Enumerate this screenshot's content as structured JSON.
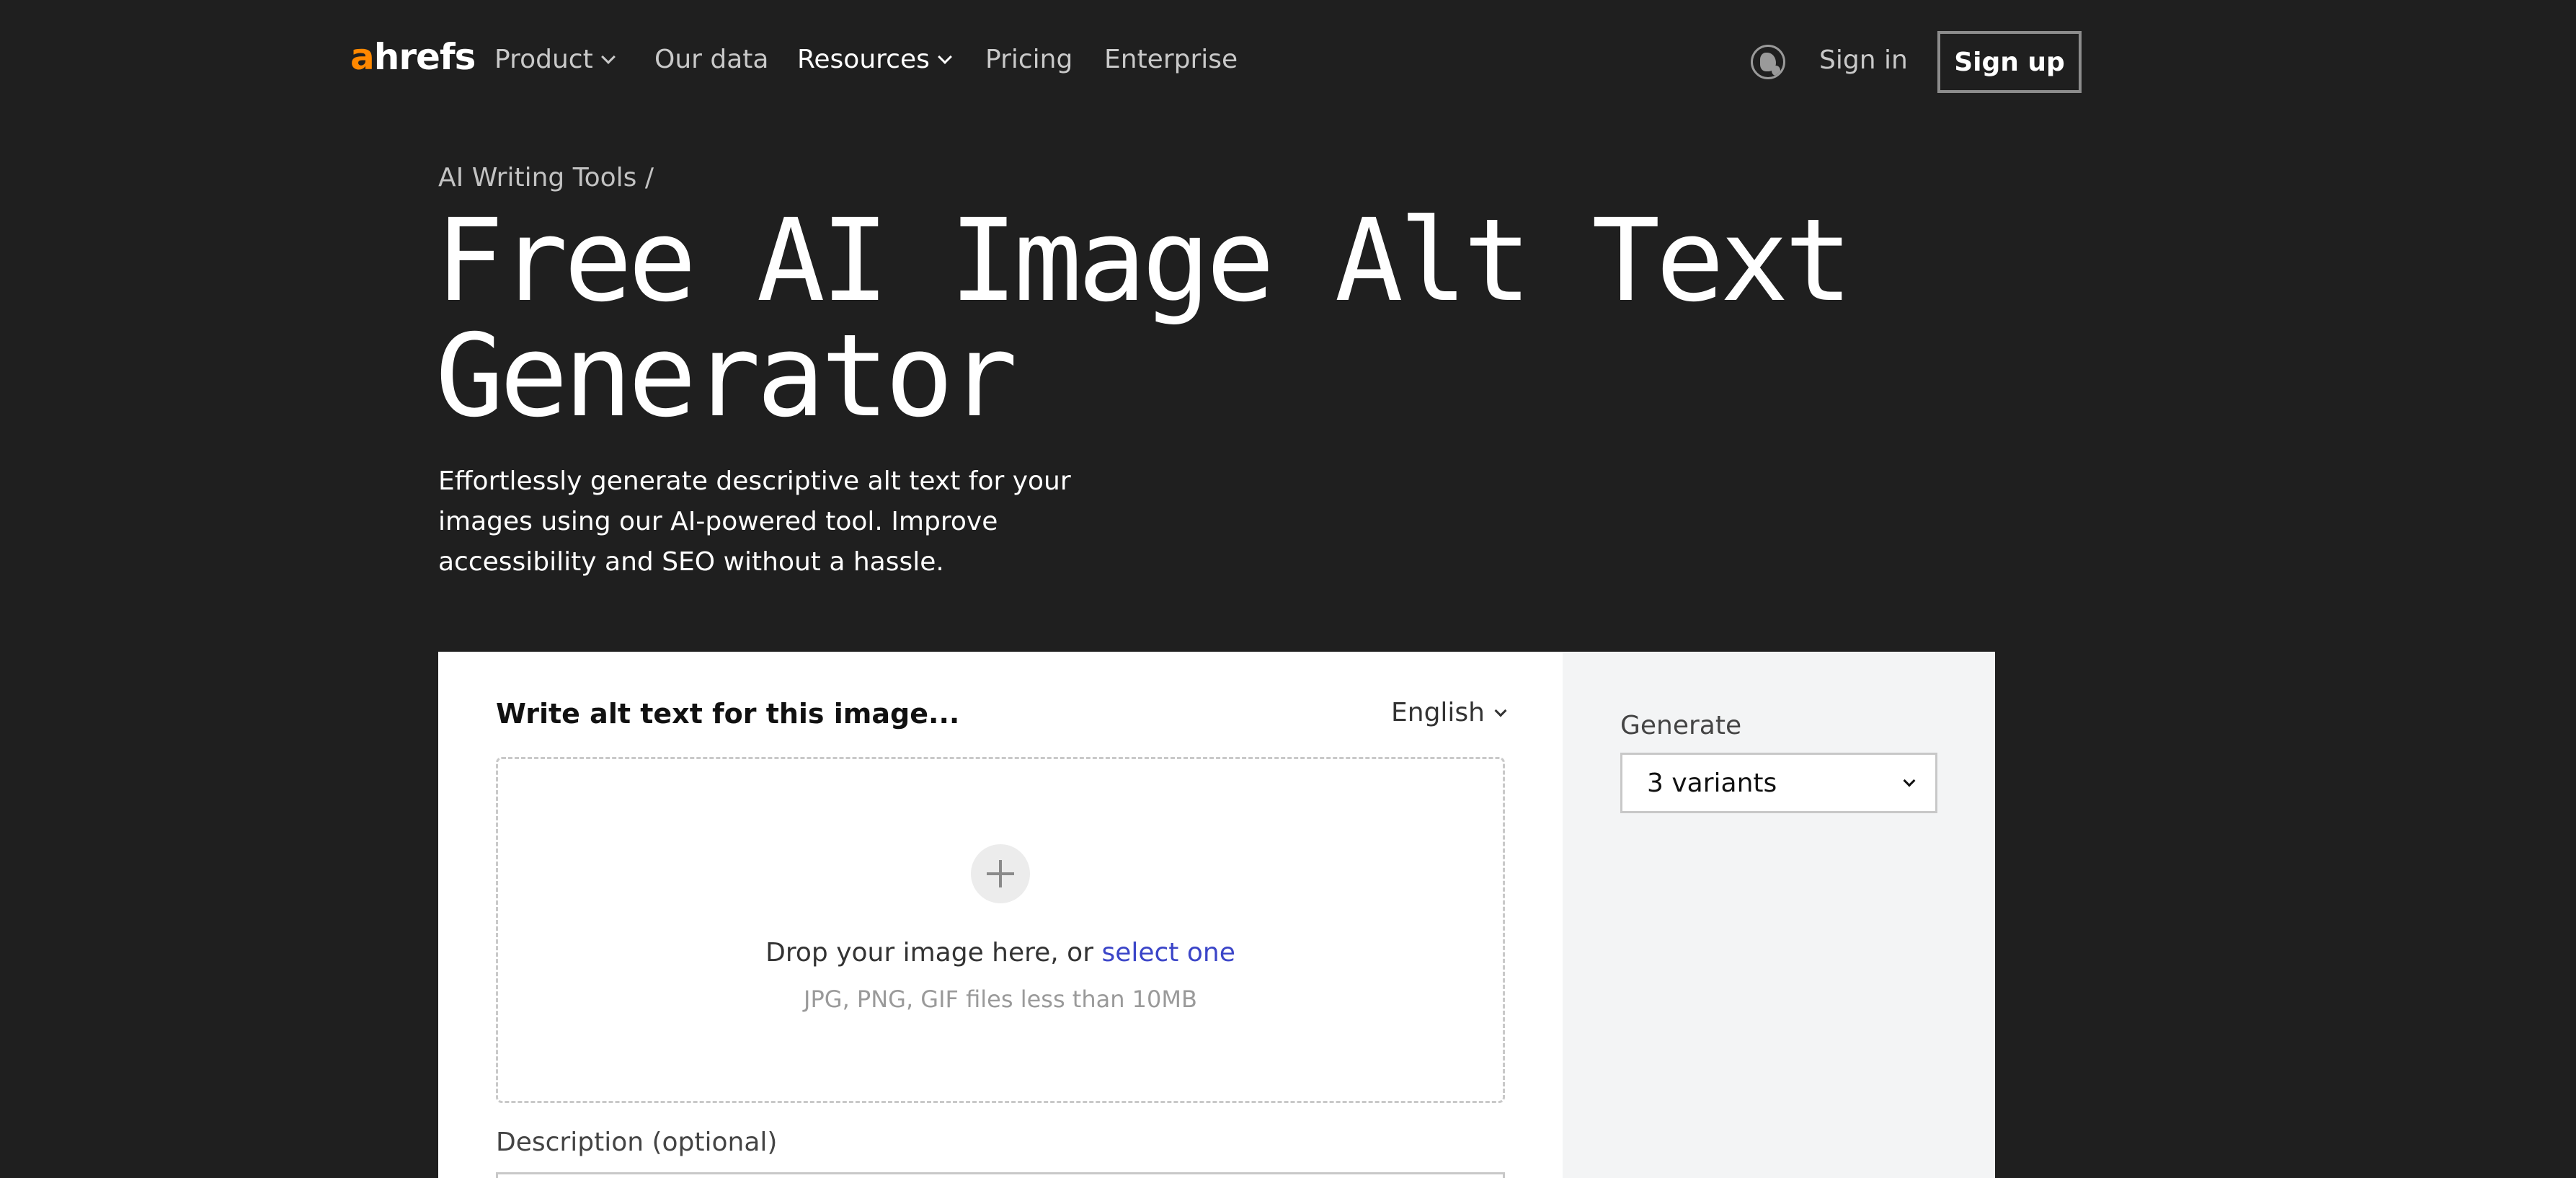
{
  "nav": {
    "logo_a": "a",
    "logo_rest": "hrefs",
    "items": [
      {
        "label": "Product",
        "dropdown": true
      },
      {
        "label": "Our data",
        "dropdown": false
      },
      {
        "label": "Resources",
        "dropdown": true
      },
      {
        "label": "Pricing",
        "dropdown": false
      },
      {
        "label": "Enterprise",
        "dropdown": false
      }
    ],
    "sign_in": "Sign in",
    "sign_up": "Sign up"
  },
  "hero": {
    "breadcrumb": "AI Writing Tools /",
    "title_line1": "Free AI Image Alt Text",
    "title_line2": "Generator",
    "subtitle": "Effortlessly generate descriptive alt text for your images using our AI-powered tool. Improve accessibility and SEO without a hassle."
  },
  "tool": {
    "card_title": "Write alt text for this image...",
    "language": "English",
    "drop_text": "Drop your image here, or",
    "drop_link": "select one",
    "drop_hint": "JPG, PNG, GIF files less than 10MB",
    "description_label": "Description (optional)",
    "generate_label": "Generate",
    "generate_value": "3 variants"
  },
  "colors": {
    "background": "#1f1f1f",
    "brand_orange": "#ff8800",
    "link_blue": "#3b45c8",
    "side_panel": "#f3f4f5"
  },
  "icons": [
    "globe-icon",
    "chevron-down-icon",
    "plus-icon"
  ]
}
